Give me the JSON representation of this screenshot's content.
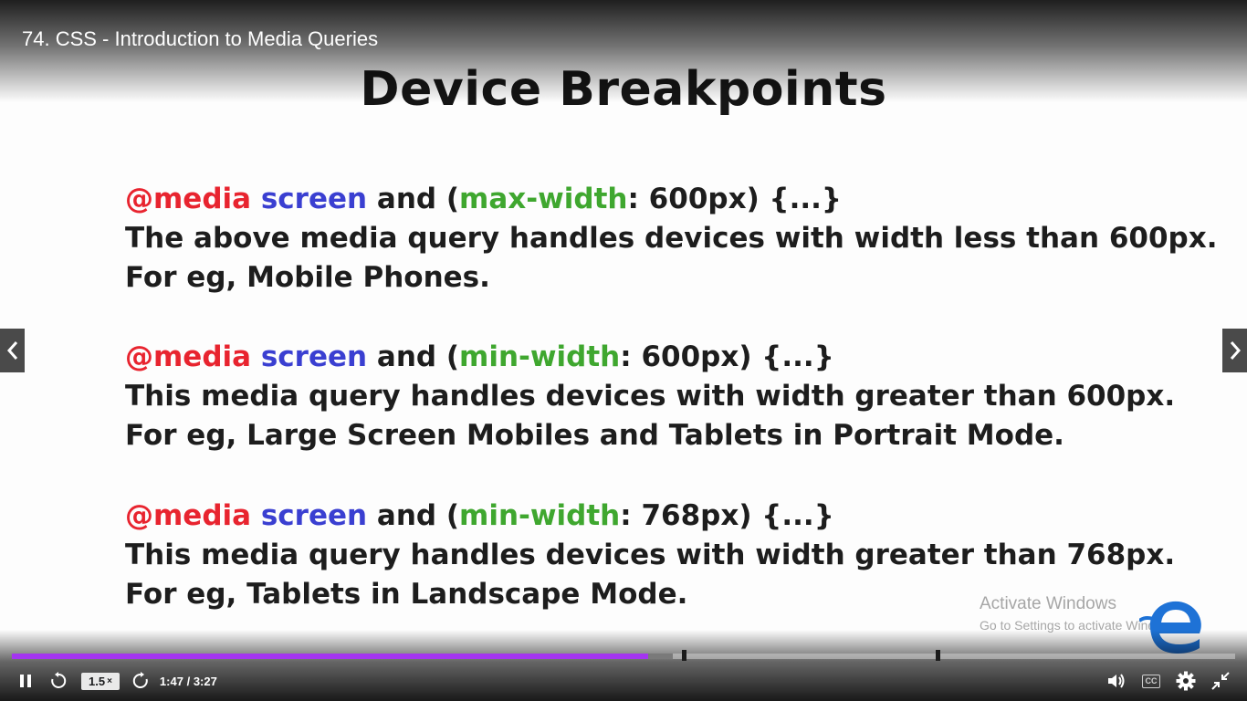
{
  "player": {
    "title": "74. CSS - Introduction to Media Queries",
    "speed": "1.5",
    "speed_suffix": "×",
    "current_time": "1:47",
    "time_separator": "/",
    "duration": "3:27",
    "progress_fraction": 0.52,
    "buffered_fraction": 0.54,
    "progress_color": "#a435f0"
  },
  "slide": {
    "title": "Device Breakpoints",
    "blocks": [
      {
        "at_media": "@media",
        "screen": "screen",
        "and_paren": "and (",
        "feature": "max-width",
        "value": ": 600px) {...}",
        "desc": "The above media query handles devices with width less than 600px.",
        "example": "For eg, Mobile Phones."
      },
      {
        "at_media": "@media",
        "screen": "screen",
        "and_paren": "and (",
        "feature": "min-width",
        "value": ": 600px) {...}",
        "desc": "This media query handles devices with width greater than 600px.",
        "example": "For eg, Large Screen Mobiles and Tablets in Portrait Mode."
      },
      {
        "at_media": "@media",
        "screen": "screen",
        "and_paren": "and (",
        "feature": "min-width",
        "value": ": 768px) {...}",
        "desc": "This media query handles devices with width greater than 768px.",
        "example": "For eg, Tablets in Landscape Mode."
      }
    ]
  },
  "watermark": {
    "title": "Activate Windows",
    "subtitle": "Go to Settings to activate Windows."
  },
  "icons": {
    "prev": "chevron-left-icon",
    "next": "chevron-right-icon",
    "pause": "pause-icon",
    "rewind": "rewind-icon",
    "forward": "forward-icon",
    "volume": "volume-icon",
    "captions": "CC",
    "settings": "gear-icon",
    "exit_fullscreen": "exit-fullscreen-icon"
  },
  "colors": {
    "media_keyword": "#e8242f",
    "screen_keyword": "#3a3fd1",
    "feature_keyword": "#3fa72f"
  }
}
